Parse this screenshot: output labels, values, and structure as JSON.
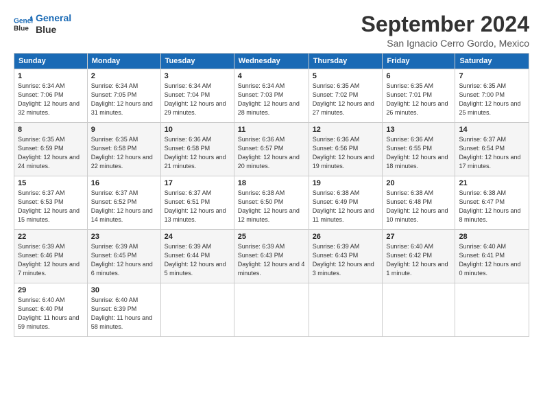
{
  "logo": {
    "line1": "General",
    "line2": "Blue"
  },
  "title": "September 2024",
  "subtitle": "San Ignacio Cerro Gordo, Mexico",
  "days_of_week": [
    "Sunday",
    "Monday",
    "Tuesday",
    "Wednesday",
    "Thursday",
    "Friday",
    "Saturday"
  ],
  "weeks": [
    [
      {
        "day": "1",
        "sunrise": "6:34 AM",
        "sunset": "7:06 PM",
        "daylight": "12 hours and 32 minutes."
      },
      {
        "day": "2",
        "sunrise": "6:34 AM",
        "sunset": "7:05 PM",
        "daylight": "12 hours and 31 minutes."
      },
      {
        "day": "3",
        "sunrise": "6:34 AM",
        "sunset": "7:04 PM",
        "daylight": "12 hours and 29 minutes."
      },
      {
        "day": "4",
        "sunrise": "6:34 AM",
        "sunset": "7:03 PM",
        "daylight": "12 hours and 28 minutes."
      },
      {
        "day": "5",
        "sunrise": "6:35 AM",
        "sunset": "7:02 PM",
        "daylight": "12 hours and 27 minutes."
      },
      {
        "day": "6",
        "sunrise": "6:35 AM",
        "sunset": "7:01 PM",
        "daylight": "12 hours and 26 minutes."
      },
      {
        "day": "7",
        "sunrise": "6:35 AM",
        "sunset": "7:00 PM",
        "daylight": "12 hours and 25 minutes."
      }
    ],
    [
      {
        "day": "8",
        "sunrise": "6:35 AM",
        "sunset": "6:59 PM",
        "daylight": "12 hours and 24 minutes."
      },
      {
        "day": "9",
        "sunrise": "6:35 AM",
        "sunset": "6:58 PM",
        "daylight": "12 hours and 22 minutes."
      },
      {
        "day": "10",
        "sunrise": "6:36 AM",
        "sunset": "6:58 PM",
        "daylight": "12 hours and 21 minutes."
      },
      {
        "day": "11",
        "sunrise": "6:36 AM",
        "sunset": "6:57 PM",
        "daylight": "12 hours and 20 minutes."
      },
      {
        "day": "12",
        "sunrise": "6:36 AM",
        "sunset": "6:56 PM",
        "daylight": "12 hours and 19 minutes."
      },
      {
        "day": "13",
        "sunrise": "6:36 AM",
        "sunset": "6:55 PM",
        "daylight": "12 hours and 18 minutes."
      },
      {
        "day": "14",
        "sunrise": "6:37 AM",
        "sunset": "6:54 PM",
        "daylight": "12 hours and 17 minutes."
      }
    ],
    [
      {
        "day": "15",
        "sunrise": "6:37 AM",
        "sunset": "6:53 PM",
        "daylight": "12 hours and 15 minutes."
      },
      {
        "day": "16",
        "sunrise": "6:37 AM",
        "sunset": "6:52 PM",
        "daylight": "12 hours and 14 minutes."
      },
      {
        "day": "17",
        "sunrise": "6:37 AM",
        "sunset": "6:51 PM",
        "daylight": "12 hours and 13 minutes."
      },
      {
        "day": "18",
        "sunrise": "6:38 AM",
        "sunset": "6:50 PM",
        "daylight": "12 hours and 12 minutes."
      },
      {
        "day": "19",
        "sunrise": "6:38 AM",
        "sunset": "6:49 PM",
        "daylight": "12 hours and 11 minutes."
      },
      {
        "day": "20",
        "sunrise": "6:38 AM",
        "sunset": "6:48 PM",
        "daylight": "12 hours and 10 minutes."
      },
      {
        "day": "21",
        "sunrise": "6:38 AM",
        "sunset": "6:47 PM",
        "daylight": "12 hours and 8 minutes."
      }
    ],
    [
      {
        "day": "22",
        "sunrise": "6:39 AM",
        "sunset": "6:46 PM",
        "daylight": "12 hours and 7 minutes."
      },
      {
        "day": "23",
        "sunrise": "6:39 AM",
        "sunset": "6:45 PM",
        "daylight": "12 hours and 6 minutes."
      },
      {
        "day": "24",
        "sunrise": "6:39 AM",
        "sunset": "6:44 PM",
        "daylight": "12 hours and 5 minutes."
      },
      {
        "day": "25",
        "sunrise": "6:39 AM",
        "sunset": "6:43 PM",
        "daylight": "12 hours and 4 minutes."
      },
      {
        "day": "26",
        "sunrise": "6:39 AM",
        "sunset": "6:43 PM",
        "daylight": "12 hours and 3 minutes."
      },
      {
        "day": "27",
        "sunrise": "6:40 AM",
        "sunset": "6:42 PM",
        "daylight": "12 hours and 1 minute."
      },
      {
        "day": "28",
        "sunrise": "6:40 AM",
        "sunset": "6:41 PM",
        "daylight": "12 hours and 0 minutes."
      }
    ],
    [
      {
        "day": "29",
        "sunrise": "6:40 AM",
        "sunset": "6:40 PM",
        "daylight": "11 hours and 59 minutes."
      },
      {
        "day": "30",
        "sunrise": "6:40 AM",
        "sunset": "6:39 PM",
        "daylight": "11 hours and 58 minutes."
      },
      null,
      null,
      null,
      null,
      null
    ]
  ],
  "label_sunrise": "Sunrise:",
  "label_sunset": "Sunset:",
  "label_daylight": "Daylight: "
}
